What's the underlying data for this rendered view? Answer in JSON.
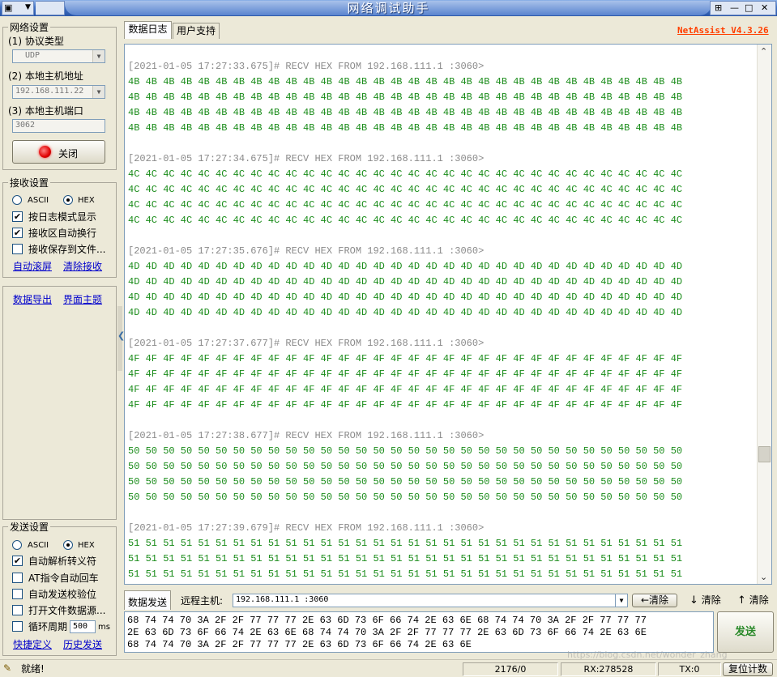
{
  "window": {
    "title": "网络调试助手",
    "version": "NetAssist V4.3.26"
  },
  "tabs": [
    {
      "label": "数据日志"
    },
    {
      "label": "用户支持"
    }
  ],
  "network": {
    "title": "网络设置",
    "protocol_label": "(1) 协议类型",
    "protocol_value": "UDP",
    "host_label": "(2) 本地主机地址",
    "host_value": "192.168.111.22",
    "port_label": "(3) 本地主机端口",
    "port_value": "3062",
    "close_button": "关闭",
    "status_color": "#e00000"
  },
  "receive": {
    "title": "接收设置",
    "ascii_label": "ASCII",
    "hex_label": "HEX",
    "mode_selected": "HEX",
    "log_mode": {
      "label": "按日志模式显示",
      "checked": true
    },
    "auto_wrap": {
      "label": "接收区自动换行",
      "checked": true
    },
    "save_file": {
      "label": "接收保存到文件...",
      "checked": false
    },
    "auto_scroll_link": "自动滚屏",
    "clear_link": "清除接收"
  },
  "extra": {
    "export_link": "数据导出",
    "theme_link": "界面主题"
  },
  "send_settings": {
    "title": "发送设置",
    "ascii_label": "ASCII",
    "hex_label": "HEX",
    "mode_selected": "HEX",
    "auto_escape": {
      "label": "自动解析转义符",
      "checked": true
    },
    "at_auto_cr": {
      "label": "AT指令自动回车",
      "checked": false
    },
    "auto_checksum": {
      "label": "自动发送校验位",
      "checked": false
    },
    "open_file": {
      "label": "打开文件数据源...",
      "checked": false
    },
    "loop": {
      "label": "循环周期",
      "checked": false,
      "value": "500",
      "unit": "ms"
    },
    "shortcut_link": "快捷定义",
    "history_link": "历史发送"
  },
  "log": [
    {
      "header": "[2021-01-05 17:27:33.675]# RECV HEX FROM 192.168.111.1 :3060>",
      "byte": "4B",
      "per_line": 32,
      "lines": 4
    },
    {
      "header": "[2021-01-05 17:27:34.675]# RECV HEX FROM 192.168.111.1 :3060>",
      "byte": "4C",
      "per_line": 32,
      "lines": 4
    },
    {
      "header": "[2021-01-05 17:27:35.676]# RECV HEX FROM 192.168.111.1 :3060>",
      "byte": "4D",
      "per_line": 32,
      "lines": 4
    },
    {
      "header": "[2021-01-05 17:27:37.677]# RECV HEX FROM 192.168.111.1 :3060>",
      "byte": "4F",
      "per_line": 32,
      "lines": 4
    },
    {
      "header": "[2021-01-05 17:27:38.677]# RECV HEX FROM 192.168.111.1 :3060>",
      "byte": "50",
      "per_line": 32,
      "lines": 4
    },
    {
      "header": "[2021-01-05 17:27:39.679]# RECV HEX FROM 192.168.111.1 :3060>",
      "byte": "51",
      "per_line": 32,
      "lines": 4
    }
  ],
  "send_bar": {
    "label": "数据发送",
    "remote_label": "远程主机:",
    "remote_value": "192.168.111.1 :3060",
    "clear_back": "清除",
    "clear_down": "清除",
    "clear_up": "清除"
  },
  "send_text": [
    "68 74 74 70 3A 2F 2F 77 77 77 2E 63 6D 73 6F 66 74 2E 63 6E 68 74 74 70 3A 2F 2F 77 77 77",
    "2E 63 6D 73 6F 66 74 2E 63 6E 68 74 74 70 3A 2F 2F 77 77 77 2E 63 6D 73 6F 66 74 2E 63 6E",
    "68 74 74 70 3A 2F 2F 77 77 77 2E 63 6D 73 6F 66 74 2E 63 6E"
  ],
  "send_button": "发送",
  "statusbar": {
    "ready": "就绪!",
    "tx_rx": "2176/0",
    "rx": "RX:278528",
    "tx": "TX:0",
    "reset": "复位计数"
  },
  "watermark": "https://blog.csdn.net/wonder_zhang"
}
